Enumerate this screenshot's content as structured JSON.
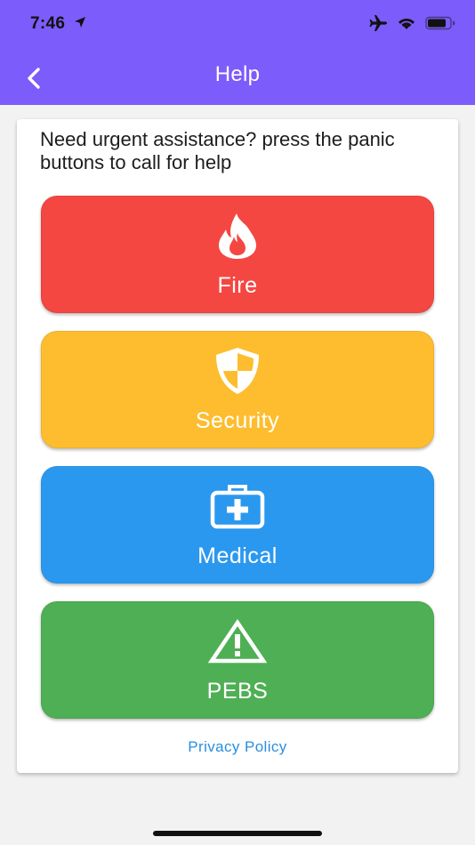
{
  "status_bar": {
    "time": "7:46",
    "icons": [
      "location-arrow-icon",
      "airplane-icon",
      "wifi-icon",
      "battery-icon"
    ]
  },
  "app_bar": {
    "title": "Help",
    "back_icon": "chevron-left-icon",
    "color": "#7c5cfa"
  },
  "intro_text": "Need urgent assistance? press the panic buttons to call for help",
  "panic_buttons": [
    {
      "label": "Fire",
      "icon": "flame-icon",
      "color": "#f44742"
    },
    {
      "label": "Security",
      "icon": "shield-icon",
      "color": "#fdbd2e"
    },
    {
      "label": "Medical",
      "icon": "medical-kit-icon",
      "color": "#2a98ef"
    },
    {
      "label": "PEBS",
      "icon": "warning-triangle-icon",
      "color": "#4faf54"
    }
  ],
  "privacy_link": "Privacy Policy"
}
